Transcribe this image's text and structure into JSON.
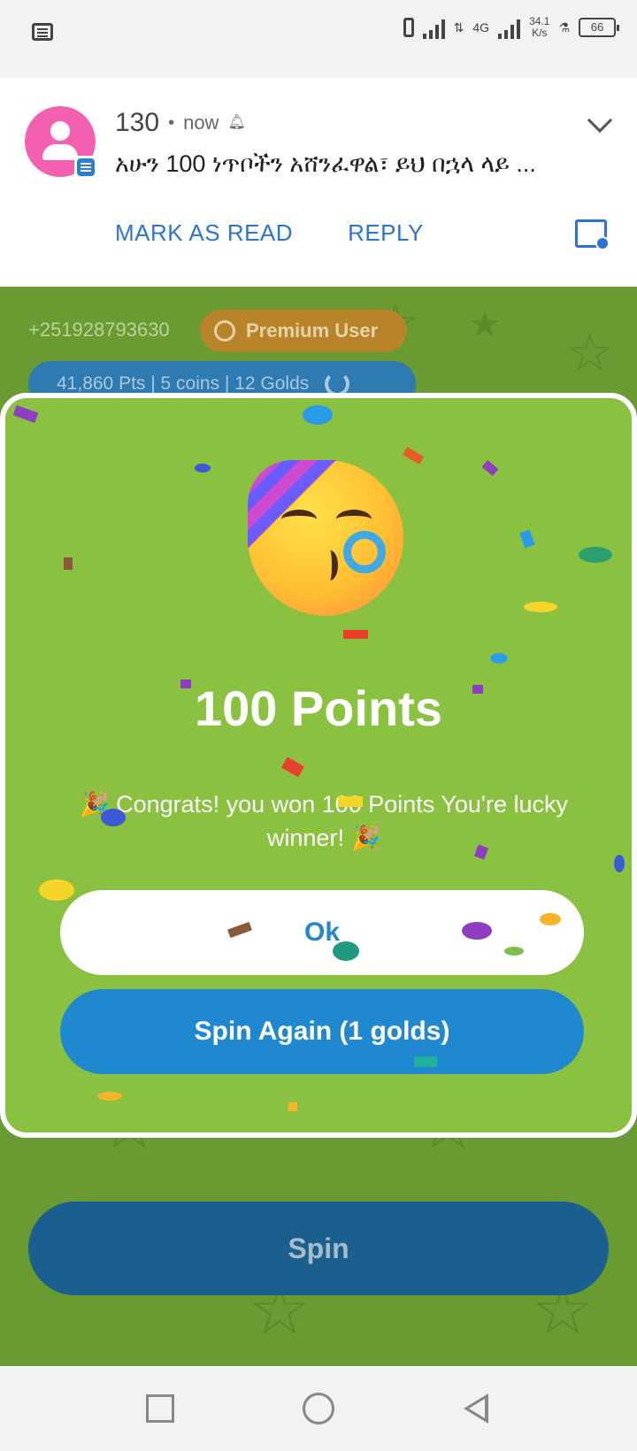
{
  "status_bar": {
    "network": "4G",
    "net_speed_value": "34.1",
    "net_speed_unit": "K/s",
    "battery": "66"
  },
  "notification": {
    "sender": "130",
    "separator": "•",
    "time": "now",
    "message": "አሁን 100 ነጥቦችን አሸንፈዋል፣ ይህ በኋላ ላይ ...",
    "actions": [
      "MARK AS READ",
      "REPLY"
    ]
  },
  "app": {
    "phone_number": "+251928793630",
    "badge_label": "Premium User",
    "stats": "41,860 Pts | 5 coins | 12 Golds",
    "spin_label": "Spin"
  },
  "dialog": {
    "title": "100 Points",
    "message": "🎉 Congrats! you won 100 Points You're lucky winner! 🎉",
    "ok_label": "Ok",
    "spin_again_label": "Spin Again (1 golds)"
  },
  "colors": {
    "dialog_bg": "#8bc140",
    "primary_blue": "#2088cf",
    "link_blue": "#2b74d0",
    "avatar_pink": "#f360b0",
    "premium_gold": "#b8842a"
  },
  "icons": {
    "status_left": "message-icon",
    "notification_avatar": "contact-avatar-icon",
    "expand": "chevron-down-icon",
    "popup": "open-in-window-icon",
    "badge": "award-icon",
    "refresh": "refresh-icon",
    "emoji": "partying-face-emoji",
    "nav": [
      "recent-apps-icon",
      "home-icon",
      "back-icon"
    ]
  }
}
